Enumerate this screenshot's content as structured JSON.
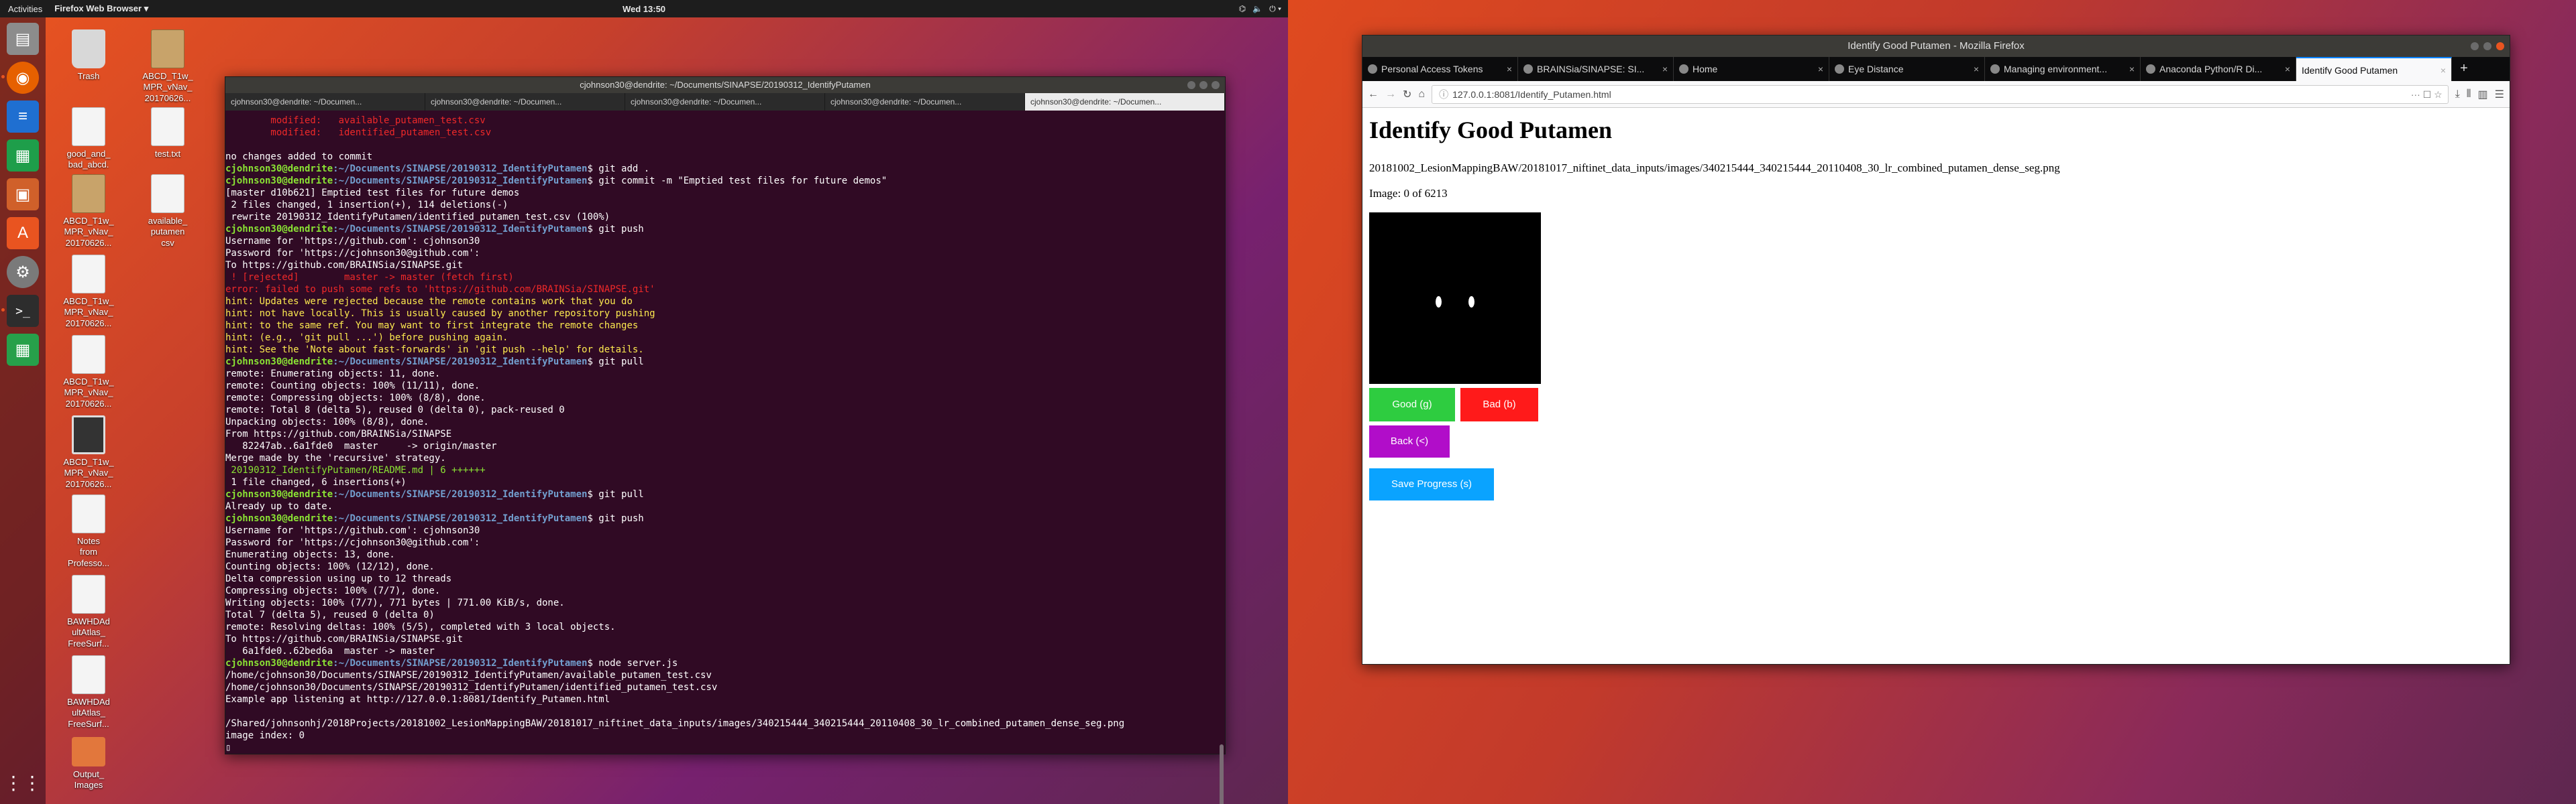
{
  "topbar": {
    "activities": "Activities",
    "app_menu": "Firefox Web Browser ▾",
    "clock": "Wed 13:50",
    "tray_icons": [
      "network-icon",
      "volume-icon",
      "power-icon"
    ]
  },
  "dock": {
    "items": [
      "files-icon",
      "firefox-icon",
      "writer-icon",
      "calc-icon",
      "impress-icon",
      "software-icon",
      "settings-icon",
      "terminal-icon",
      "spreadsheet-icon",
      "apps-grid-icon"
    ]
  },
  "desktop_icons": [
    {
      "label": "Trash"
    },
    {
      "label": "ABCD_T1w_\nMPR_vNav_\n20170626..."
    },
    {
      "label": "good_and_\nbad_abcd.\ncsv"
    },
    {
      "label": "test.txt"
    },
    {
      "label": "ABCD_T1w_\nMPR_vNav_\n20170626..."
    },
    {
      "label": "available_\nputamen\ncsv"
    },
    {
      "label": "ABCD_T1w_\nMPR_vNav_\n20170626..."
    },
    {
      "label": "ABCD_T1w_\nMPR_vNav_\n20170626..."
    },
    {
      "label": "ABCD_T1w_\nMPR_vNav_\n20170626..."
    },
    {
      "label": "Notes\nfrom\nProfesso..."
    },
    {
      "label": "BAWHDAd\nultAtlas_\nFreeSurf..."
    },
    {
      "label": "BAWHDAd\nultAtlas_\nFreeSurf..."
    },
    {
      "label": "Output_\nImages"
    }
  ],
  "terminal": {
    "title": "cjohnson30@dendrite: ~/Documents/SINAPSE/20190312_IdentifyPutamen",
    "tabs": [
      "cjohnson30@dendrite: ~/Documen...",
      "cjohnson30@dendrite: ~/Documen...",
      "cjohnson30@dendrite: ~/Documen...",
      "cjohnson30@dendrite: ~/Documen...",
      "cjohnson30@dendrite: ~/Documen..."
    ],
    "prompt_user": "cjohnson30@dendrite",
    "prompt_path": ":~/Documents/SINAPSE/20190312_IdentifyPutamen",
    "lines": [
      {
        "t": "        modified:   available_putamen_test.csv",
        "c": "red"
      },
      {
        "t": "        modified:   identified_putamen_test.csv",
        "c": "red"
      },
      {
        "t": "",
        "c": ""
      },
      {
        "t": "no changes added to commit",
        "c": ""
      },
      {
        "t": "$ git add .",
        "c": "prompt"
      },
      {
        "t": "$ git commit -m \"Emptied test files for future demos\"",
        "c": "prompt"
      },
      {
        "t": "[master d10b621] Emptied test files for future demos",
        "c": ""
      },
      {
        "t": " 2 files changed, 1 insertion(+), 114 deletions(-)",
        "c": ""
      },
      {
        "t": " rewrite 20190312_IdentifyPutamen/identified_putamen_test.csv (100%)",
        "c": ""
      },
      {
        "t": "$ git push",
        "c": "prompt"
      },
      {
        "t": "Username for 'https://github.com': cjohnson30",
        "c": ""
      },
      {
        "t": "Password for 'https://cjohnson30@github.com':",
        "c": ""
      },
      {
        "t": "To https://github.com/BRAINSia/SINAPSE.git",
        "c": ""
      },
      {
        "t": " ! [rejected]        master -> master (fetch first)",
        "c": "rejected"
      },
      {
        "t": "error: failed to push some refs to 'https://github.com/BRAINSia/SINAPSE.git'",
        "c": "red"
      },
      {
        "t": "hint: Updates were rejected because the remote contains work that you do",
        "c": "hint"
      },
      {
        "t": "hint: not have locally. This is usually caused by another repository pushing",
        "c": "hint"
      },
      {
        "t": "hint: to the same ref. You may want to first integrate the remote changes",
        "c": "hint"
      },
      {
        "t": "hint: (e.g., 'git pull ...') before pushing again.",
        "c": "hint"
      },
      {
        "t": "hint: See the 'Note about fast-forwards' in 'git push --help' for details.",
        "c": "hint"
      },
      {
        "t": "$ git pull",
        "c": "prompt"
      },
      {
        "t": "remote: Enumerating objects: 11, done.",
        "c": ""
      },
      {
        "t": "remote: Counting objects: 100% (11/11), done.",
        "c": ""
      },
      {
        "t": "remote: Compressing objects: 100% (8/8), done.",
        "c": ""
      },
      {
        "t": "remote: Total 8 (delta 5), reused 0 (delta 0), pack-reused 0",
        "c": ""
      },
      {
        "t": "Unpacking objects: 100% (8/8), done.",
        "c": ""
      },
      {
        "t": "From https://github.com/BRAINSia/SINAPSE",
        "c": ""
      },
      {
        "t": "   82247ab..6a1fde0  master     -> origin/master",
        "c": ""
      },
      {
        "t": "Merge made by the 'recursive' strategy.",
        "c": ""
      },
      {
        "t": " 20190312_IdentifyPutamen/README.md | 6 ++++++",
        "c": "plus"
      },
      {
        "t": " 1 file changed, 6 insertions(+)",
        "c": ""
      },
      {
        "t": "$ git pull",
        "c": "prompt"
      },
      {
        "t": "Already up to date.",
        "c": ""
      },
      {
        "t": "$ git push",
        "c": "prompt"
      },
      {
        "t": "Username for 'https://github.com': cjohnson30",
        "c": ""
      },
      {
        "t": "Password for 'https://cjohnson30@github.com':",
        "c": ""
      },
      {
        "t": "Enumerating objects: 13, done.",
        "c": ""
      },
      {
        "t": "Counting objects: 100% (12/12), done.",
        "c": ""
      },
      {
        "t": "Delta compression using up to 12 threads",
        "c": ""
      },
      {
        "t": "Compressing objects: 100% (7/7), done.",
        "c": ""
      },
      {
        "t": "Writing objects: 100% (7/7), 771 bytes | 771.00 KiB/s, done.",
        "c": ""
      },
      {
        "t": "Total 7 (delta 5), reused 0 (delta 0)",
        "c": ""
      },
      {
        "t": "remote: Resolving deltas: 100% (5/5), completed with 3 local objects.",
        "c": ""
      },
      {
        "t": "To https://github.com/BRAINSia/SINAPSE.git",
        "c": ""
      },
      {
        "t": "   6a1fde0..62bed6a  master -> master",
        "c": ""
      },
      {
        "t": "$ node server.js",
        "c": "prompt"
      },
      {
        "t": "/home/cjohnson30/Documents/SINAPSE/20190312_IdentifyPutamen/available_putamen_test.csv",
        "c": ""
      },
      {
        "t": "/home/cjohnson30/Documents/SINAPSE/20190312_IdentifyPutamen/identified_putamen_test.csv",
        "c": ""
      },
      {
        "t": "Example app listening at http://127.0.0.1:8081/Identify_Putamen.html",
        "c": ""
      },
      {
        "t": "",
        "c": ""
      },
      {
        "t": "/Shared/johnsonhj/2018Projects/20181002_LesionMappingBAW/20181017_niftinet_data_inputs/images/340215444_340215444_20110408_30_lr_combined_putamen_dense_seg.png",
        "c": ""
      },
      {
        "t": "image index: 0",
        "c": ""
      },
      {
        "t": "▯",
        "c": ""
      }
    ]
  },
  "firefox": {
    "window_title": "Identify Good Putamen - Mozilla Firefox",
    "tabs": [
      {
        "label": "Personal Access Tokens",
        "active": false
      },
      {
        "label": "BRAINSia/SINAPSE: SI...",
        "active": false
      },
      {
        "label": "Home",
        "active": false
      },
      {
        "label": "Eye Distance",
        "active": false
      },
      {
        "label": "Managing environment...",
        "active": false
      },
      {
        "label": "Anaconda Python/R Di...",
        "active": false
      },
      {
        "label": "Identify Good Putamen",
        "active": true
      }
    ],
    "url": "127.0.0.1:8081/Identify_Putamen.html",
    "url_more": "···",
    "page": {
      "heading": "Identify Good Putamen",
      "image_path": "20181002_LesionMappingBAW/20181017_niftinet_data_inputs/images/340215444_340215444_20110408_30_lr_combined_putamen_dense_seg.png",
      "image_counter": "Image: 0 of 6213",
      "good_label": "Good (g)",
      "bad_label": "Bad (b)",
      "back_label": "Back (<)",
      "save_label": "Save Progress (s)"
    }
  },
  "colors": {
    "good": "#2ecc40",
    "bad": "#ff1a1a",
    "back": "#b10dc9",
    "save": "#0aa3ff",
    "terminal_bg": "#300a24",
    "ubuntu_orange": "#e95420"
  }
}
